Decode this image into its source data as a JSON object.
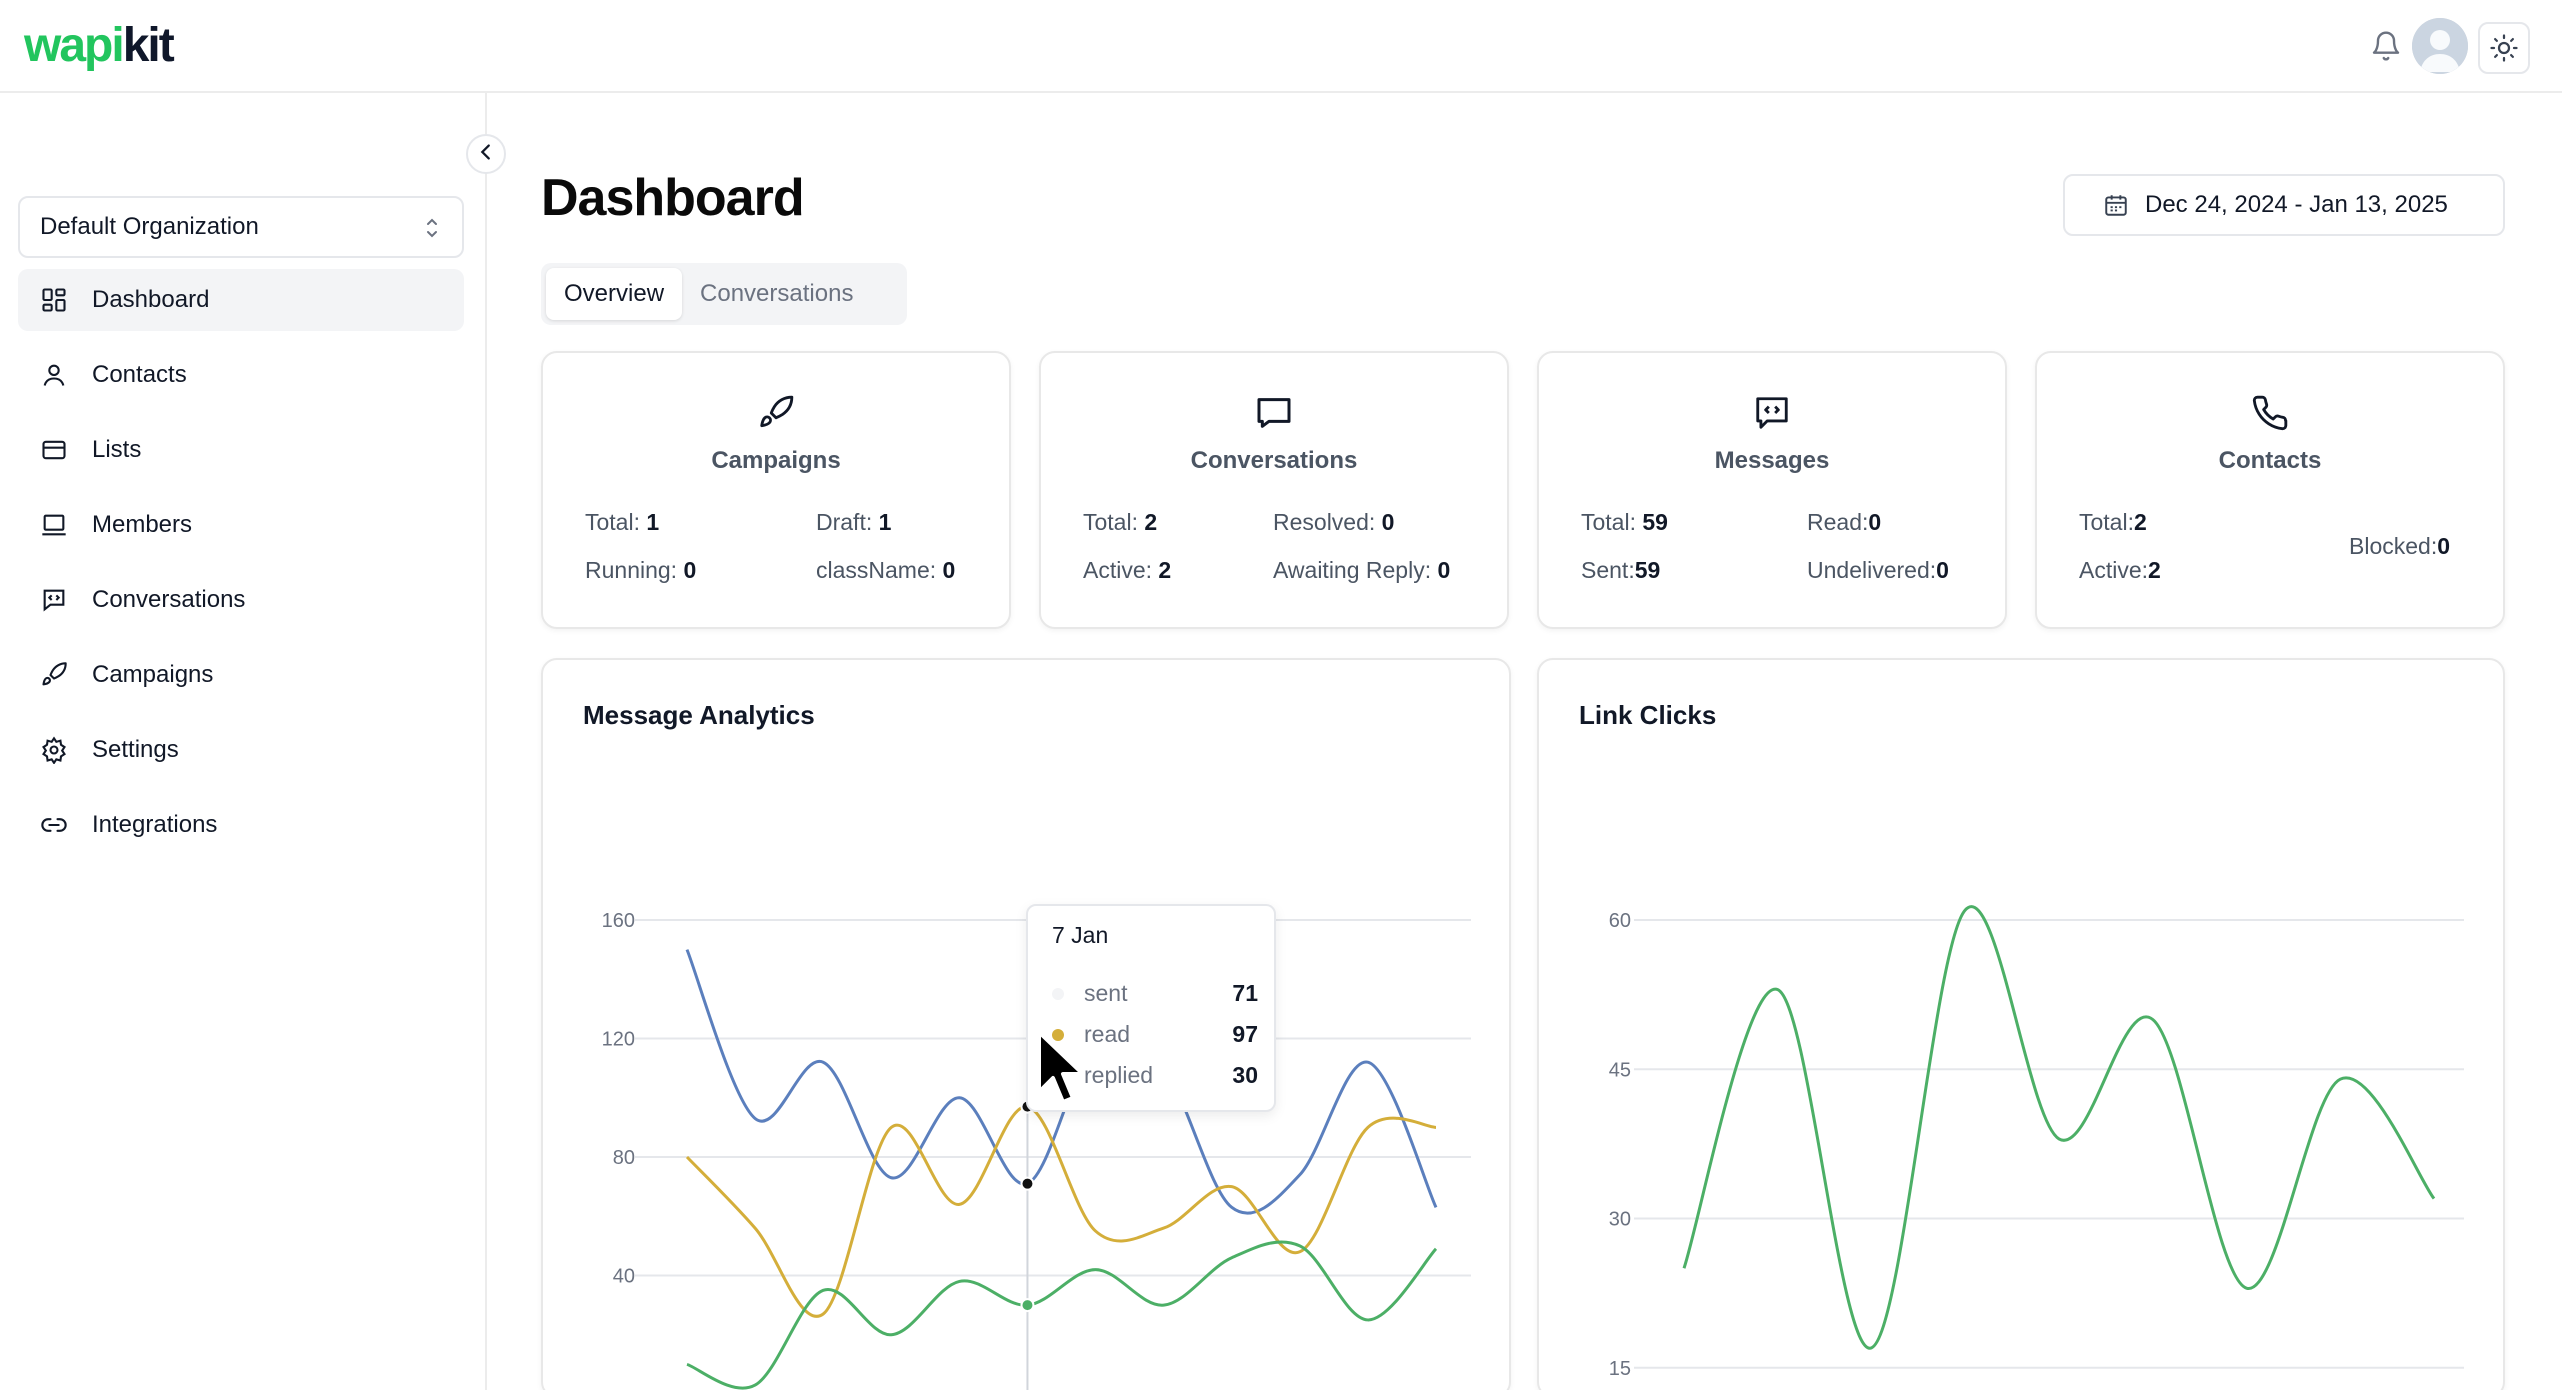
{
  "app": {
    "logo_part1": "wapi",
    "logo_part2": "kit"
  },
  "topbar": {
    "bell_icon": "bell-icon",
    "avatar_icon": "user-avatar",
    "theme_icon": "sun-icon"
  },
  "sidebar": {
    "org_select": "Default Organization",
    "items": [
      {
        "label": "Dashboard",
        "icon": "dashboard-icon",
        "active": true
      },
      {
        "label": "Contacts",
        "icon": "user-icon"
      },
      {
        "label": "Lists",
        "icon": "list-icon"
      },
      {
        "label": "Members",
        "icon": "laptop-icon"
      },
      {
        "label": "Conversations",
        "icon": "message-icon"
      },
      {
        "label": "Campaigns",
        "icon": "rocket-icon"
      },
      {
        "label": "Settings",
        "icon": "gear-icon"
      },
      {
        "label": "Integrations",
        "icon": "link-icon"
      }
    ]
  },
  "main": {
    "title": "Dashboard",
    "date_range": "Dec 24, 2024 - Jan 13, 2025",
    "tabs": [
      "Overview",
      "Conversations"
    ]
  },
  "stats": {
    "campaigns": {
      "title": "Campaigns",
      "total_label": "Total:",
      "total": "1",
      "draft_label": "Draft:",
      "draft": "1",
      "running_label": "Running:",
      "running": "0",
      "classname_label": "className:",
      "classname": "0"
    },
    "conversations": {
      "title": "Conversations",
      "total_label": "Total:",
      "total": "2",
      "resolved_label": "Resolved:",
      "resolved": "0",
      "active_label": "Active:",
      "active": "2",
      "awaiting_label": "Awaiting Reply:",
      "awaiting": "0"
    },
    "messages": {
      "title": "Messages",
      "total_label": "Total:",
      "total": "59",
      "read_label": "Read:",
      "read": "0",
      "sent_label": "Sent:",
      "sent": "59",
      "undelivered_label": "Undelivered:",
      "undelivered": "0"
    },
    "contacts": {
      "title": "Contacts",
      "total_label": "Total:",
      "total": "2",
      "blocked_label": "Blocked:",
      "blocked": "0",
      "active_label": "Active:",
      "active": "2"
    }
  },
  "tooltip": {
    "date": "7 Jan",
    "rows": [
      {
        "name": "sent",
        "value": "71"
      },
      {
        "name": "read",
        "value": "97"
      },
      {
        "name": "replied",
        "value": "30"
      }
    ]
  },
  "colors": {
    "sent": "#5b7fbd",
    "read": "#d4ae3a",
    "replied": "#4caf66",
    "link": "#4caf66"
  },
  "chart_data": [
    {
      "type": "line",
      "title": "Message Analytics",
      "ylim": [
        0,
        160
      ],
      "yticks": [
        40,
        80,
        120,
        160
      ],
      "series": [
        {
          "name": "sent",
          "values": [
            150,
            93,
            112,
            73,
            100,
            71,
            118,
            110,
            63,
            74,
            112,
            63
          ]
        },
        {
          "name": "read",
          "values": [
            80,
            56,
            27,
            90,
            64,
            97,
            55,
            56,
            70,
            48,
            90,
            90
          ]
        },
        {
          "name": "replied",
          "values": [
            10,
            3,
            35,
            20,
            38,
            30,
            42,
            30,
            46,
            50,
            25,
            49
          ]
        }
      ]
    },
    {
      "type": "line",
      "title": "Link Clicks",
      "ylim": [
        0,
        60
      ],
      "yticks": [
        15,
        30,
        45,
        60
      ],
      "series": [
        {
          "values": [
            25,
            53,
            17,
            61,
            38,
            50,
            23,
            44,
            32
          ]
        }
      ]
    }
  ]
}
